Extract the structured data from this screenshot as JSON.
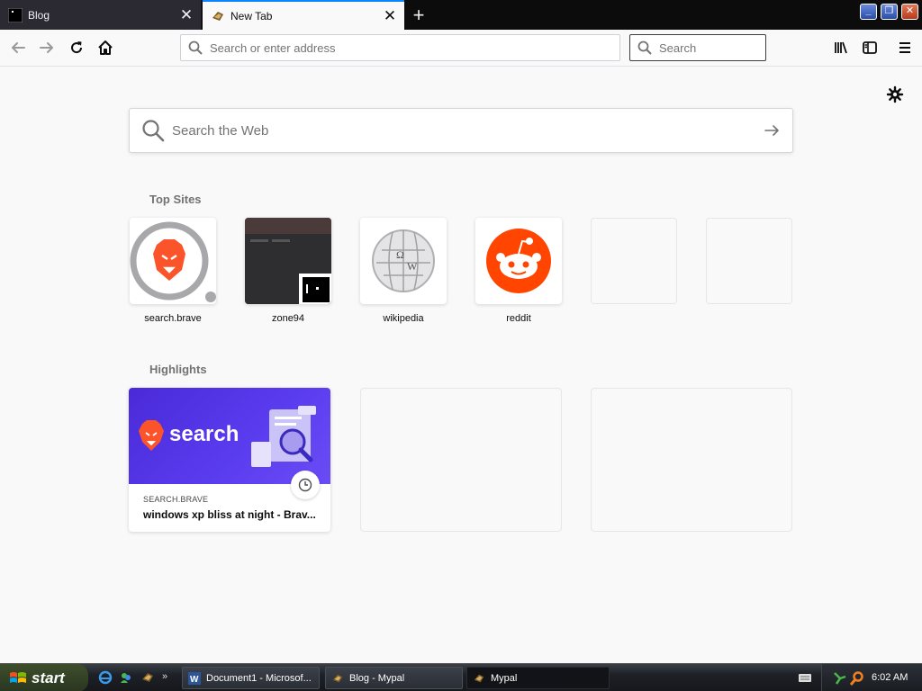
{
  "tabs": [
    {
      "title": "Blog",
      "active": false
    },
    {
      "title": "New Tab",
      "active": true
    }
  ],
  "toolbar": {
    "url_placeholder": "Search or enter address",
    "search_placeholder": "Search"
  },
  "newtab": {
    "web_search_placeholder": "Search the Web",
    "top_sites_title": "Top Sites",
    "top_sites": [
      {
        "label": "search.brave"
      },
      {
        "label": "zone94"
      },
      {
        "label": "wikipedia"
      },
      {
        "label": "reddit"
      },
      {
        "label": ""
      },
      {
        "label": ""
      }
    ],
    "highlights_title": "Highlights",
    "highlights": [
      {
        "source": "SEARCH.BRAVE",
        "title": "windows xp bliss at night - Brav...",
        "thumb_text": "search"
      }
    ]
  },
  "taskbar": {
    "start_label": "start",
    "tasks": [
      {
        "label": "Document1 - Microsof..."
      },
      {
        "label": "Blog - Mypal"
      },
      {
        "label": "Mypal"
      }
    ],
    "clock": "6:02 AM"
  },
  "colors": {
    "accent": "#0a84ff",
    "brave_orange": "#fb542b",
    "reddit_orange": "#ff4500",
    "highlight_purple": "#4a2ad8"
  }
}
